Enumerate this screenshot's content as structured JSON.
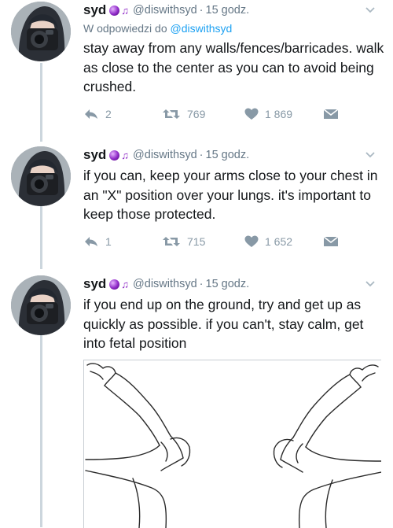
{
  "tweets": [
    {
      "name": "syd",
      "handle": "@diswithsyd",
      "separator": "·",
      "time": "15 godz.",
      "reply_prefix": "W odpowiedzi do",
      "reply_to": "@diswithsyd",
      "text": "stay away from any walls/fences/barricades. walk as close to the center as you can to avoid being crushed.",
      "replies": "2",
      "retweets": "769",
      "likes": "1 869"
    },
    {
      "name": "syd",
      "handle": "@diswithsyd",
      "separator": "·",
      "time": "15 godz.",
      "text": "if you can, keep your arms close to your chest in an \"X\" position over your lungs. it's important to keep those protected.",
      "replies": "1",
      "retweets": "715",
      "likes": "1 652"
    },
    {
      "name": "syd",
      "handle": "@diswithsyd",
      "separator": "·",
      "time": "15 godz.",
      "text": "if you end up on the ground, try and get up as quickly as possible. if you can't, stay calm, get into fetal position"
    }
  ],
  "icons": {
    "badge": "purple-crystal-ball-emoji",
    "music": "musical-notes-emoji",
    "reply": "reply-icon",
    "retweet": "retweet-icon",
    "like": "heart-icon",
    "dm": "envelope-icon",
    "more": "chevron-down-icon"
  },
  "colors": {
    "text": "#14171a",
    "secondary": "#657786",
    "link": "#1da1f2",
    "action": "#8899a6",
    "badge": "#8e2ac7",
    "thread_line": "#ccd6dd"
  }
}
